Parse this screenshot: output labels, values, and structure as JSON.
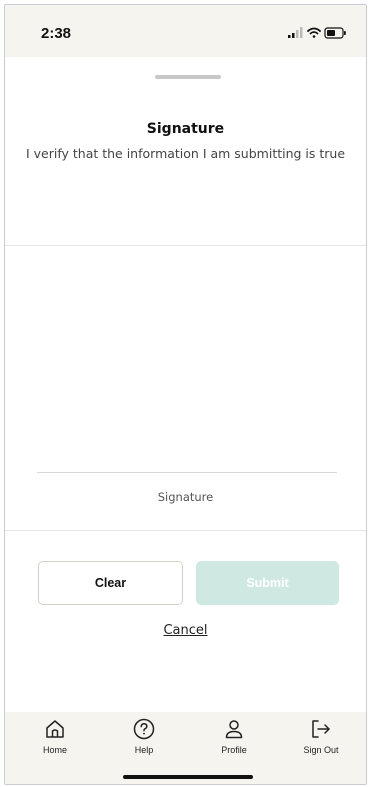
{
  "status": {
    "time": "2:38",
    "icons": [
      "signal-icon",
      "wifi-icon",
      "battery-icon"
    ]
  },
  "sheet": {
    "title": "Signature",
    "subtitle": "I verify that the information I am submitting is true",
    "signature_label": "Signature"
  },
  "actions": {
    "clear_label": "Clear",
    "submit_label": "Submit",
    "cancel_label": "Cancel"
  },
  "tabbar": {
    "items": [
      {
        "label": "Home",
        "icon": "home-icon"
      },
      {
        "label": "Help",
        "icon": "help-icon"
      },
      {
        "label": "Profile",
        "icon": "profile-icon"
      },
      {
        "label": "Sign Out",
        "icon": "sign-out-icon"
      }
    ]
  },
  "colors": {
    "background": "#ffffff",
    "bar_background": "#f6f4ef",
    "submit_disabled": "#cfe9e2",
    "text": "#222222"
  }
}
